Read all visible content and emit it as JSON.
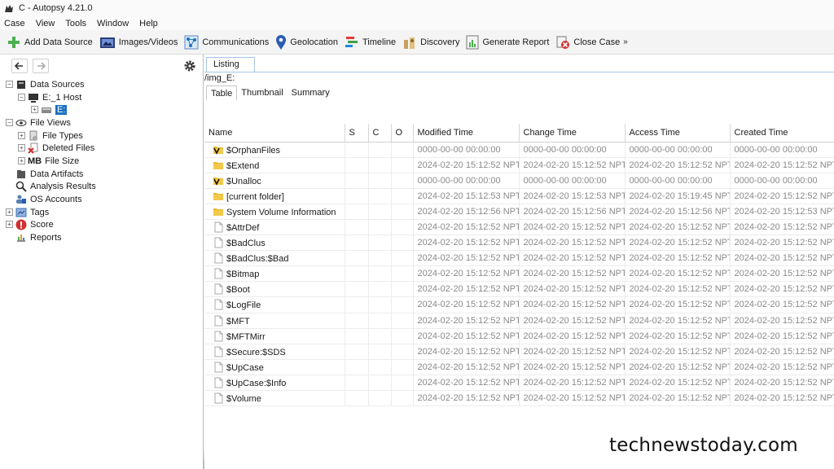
{
  "window": {
    "title": "C - Autopsy 4.21.0"
  },
  "menu": [
    "Case",
    "View",
    "Tools",
    "Window",
    "Help"
  ],
  "toolbar": {
    "buttons": [
      {
        "label": "Add Data Source",
        "icon": "add-plus-icon"
      },
      {
        "label": "Images/Videos",
        "icon": "images-icon"
      },
      {
        "label": "Communications",
        "icon": "communications-icon"
      },
      {
        "label": "Geolocation",
        "icon": "geolocation-pin-icon"
      },
      {
        "label": "Timeline",
        "icon": "timeline-icon"
      },
      {
        "label": "Discovery",
        "icon": "discovery-icon"
      },
      {
        "label": "Generate Report",
        "icon": "report-icon"
      },
      {
        "label": "Close Case",
        "icon": "close-case-icon"
      }
    ],
    "overflow": "»"
  },
  "tree": {
    "data_sources": "Data Sources",
    "host": "E:_1 Host",
    "drive": "E:",
    "file_views": "File Views",
    "file_types": "File Types",
    "deleted_files": "Deleted Files",
    "file_size_badge": "MB",
    "file_size": "File Size",
    "data_artifacts": "Data Artifacts",
    "analysis_results": "Analysis Results",
    "os_accounts": "OS Accounts",
    "tags": "Tags",
    "score": "Score",
    "reports": "Reports"
  },
  "listing": {
    "tab": "Listing",
    "path": "/img_E:",
    "subtabs": [
      "Table",
      "Thumbnail",
      "Summary"
    ]
  },
  "table": {
    "columns": [
      "Name",
      "S",
      "C",
      "O",
      "Modified Time",
      "Change Time",
      "Access Time",
      "Created Time"
    ],
    "rows": [
      {
        "name": "$OrphanFiles",
        "icon": "folder-verified",
        "modified": "0000-00-00 00:00:00",
        "change": "0000-00-00 00:00:00",
        "access": "0000-00-00 00:00:00",
        "created": "0000-00-00 00:00:00"
      },
      {
        "name": "$Extend",
        "icon": "folder",
        "modified": "2024-02-20 15:12:52 NPT",
        "change": "2024-02-20 15:12:52 NPT",
        "access": "2024-02-20 15:12:52 NPT",
        "created": "2024-02-20 15:12:52 NPT"
      },
      {
        "name": "$Unalloc",
        "icon": "folder-verified",
        "modified": "0000-00-00 00:00:00",
        "change": "0000-00-00 00:00:00",
        "access": "0000-00-00 00:00:00",
        "created": "0000-00-00 00:00:00"
      },
      {
        "name": "[current folder]",
        "icon": "folder",
        "modified": "2024-02-20 15:12:53 NPT",
        "change": "2024-02-20 15:12:53 NPT",
        "access": "2024-02-20 15:19:45 NPT",
        "created": "2024-02-20 15:12:52 NPT"
      },
      {
        "name": "System Volume Information",
        "icon": "folder",
        "modified": "2024-02-20 15:12:56 NPT",
        "change": "2024-02-20 15:12:56 NPT",
        "access": "2024-02-20 15:12:56 NPT",
        "created": "2024-02-20 15:12:53 NPT"
      },
      {
        "name": "$AttrDef",
        "icon": "file",
        "modified": "2024-02-20 15:12:52 NPT",
        "change": "2024-02-20 15:12:52 NPT",
        "access": "2024-02-20 15:12:52 NPT",
        "created": "2024-02-20 15:12:52 NPT"
      },
      {
        "name": "$BadClus",
        "icon": "file",
        "modified": "2024-02-20 15:12:52 NPT",
        "change": "2024-02-20 15:12:52 NPT",
        "access": "2024-02-20 15:12:52 NPT",
        "created": "2024-02-20 15:12:52 NPT"
      },
      {
        "name": "$BadClus:$Bad",
        "icon": "file",
        "modified": "2024-02-20 15:12:52 NPT",
        "change": "2024-02-20 15:12:52 NPT",
        "access": "2024-02-20 15:12:52 NPT",
        "created": "2024-02-20 15:12:52 NPT"
      },
      {
        "name": "$Bitmap",
        "icon": "file",
        "modified": "2024-02-20 15:12:52 NPT",
        "change": "2024-02-20 15:12:52 NPT",
        "access": "2024-02-20 15:12:52 NPT",
        "created": "2024-02-20 15:12:52 NPT"
      },
      {
        "name": "$Boot",
        "icon": "file",
        "modified": "2024-02-20 15:12:52 NPT",
        "change": "2024-02-20 15:12:52 NPT",
        "access": "2024-02-20 15:12:52 NPT",
        "created": "2024-02-20 15:12:52 NPT"
      },
      {
        "name": "$LogFile",
        "icon": "file",
        "modified": "2024-02-20 15:12:52 NPT",
        "change": "2024-02-20 15:12:52 NPT",
        "access": "2024-02-20 15:12:52 NPT",
        "created": "2024-02-20 15:12:52 NPT"
      },
      {
        "name": "$MFT",
        "icon": "file",
        "modified": "2024-02-20 15:12:52 NPT",
        "change": "2024-02-20 15:12:52 NPT",
        "access": "2024-02-20 15:12:52 NPT",
        "created": "2024-02-20 15:12:52 NPT"
      },
      {
        "name": "$MFTMirr",
        "icon": "file",
        "modified": "2024-02-20 15:12:52 NPT",
        "change": "2024-02-20 15:12:52 NPT",
        "access": "2024-02-20 15:12:52 NPT",
        "created": "2024-02-20 15:12:52 NPT"
      },
      {
        "name": "$Secure:$SDS",
        "icon": "file",
        "modified": "2024-02-20 15:12:52 NPT",
        "change": "2024-02-20 15:12:52 NPT",
        "access": "2024-02-20 15:12:52 NPT",
        "created": "2024-02-20 15:12:52 NPT"
      },
      {
        "name": "$UpCase",
        "icon": "file",
        "modified": "2024-02-20 15:12:52 NPT",
        "change": "2024-02-20 15:12:52 NPT",
        "access": "2024-02-20 15:12:52 NPT",
        "created": "2024-02-20 15:12:52 NPT"
      },
      {
        "name": "$UpCase:$Info",
        "icon": "file",
        "modified": "2024-02-20 15:12:52 NPT",
        "change": "2024-02-20 15:12:52 NPT",
        "access": "2024-02-20 15:12:52 NPT",
        "created": "2024-02-20 15:12:52 NPT"
      },
      {
        "name": "$Volume",
        "icon": "file",
        "modified": "2024-02-20 15:12:52 NPT",
        "change": "2024-02-20 15:12:52 NPT",
        "access": "2024-02-20 15:12:52 NPT",
        "created": "2024-02-20 15:12:52 NPT"
      }
    ]
  },
  "watermark": "technewstoday.com",
  "colors": {
    "folder": "#e8b830",
    "accent_blue": "#1a6fc0",
    "tab_border": "#a7c6e6",
    "dim_text": "#8a8a8a"
  }
}
